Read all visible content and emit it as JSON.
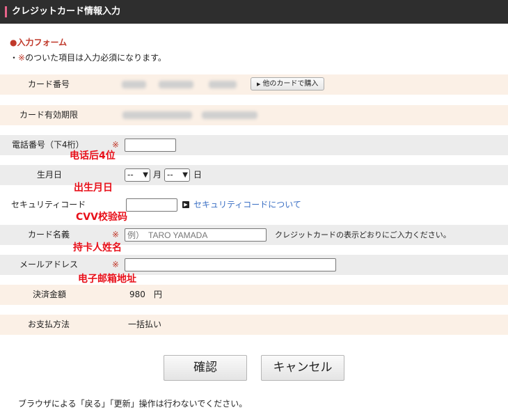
{
  "header": {
    "title": "クレジットカード情報入力"
  },
  "form_heading": "●入力フォーム",
  "note": {
    "prefix": "・",
    "req_mark": "※",
    "text": "のついた項目は入力必須になります。"
  },
  "rows": {
    "card_number": {
      "label": "カード番号",
      "other_card_button": "他のカードで購入"
    },
    "card_expiry": {
      "label": "カード有効期限"
    },
    "phone": {
      "label": "電話番号（下4桁）",
      "required": "※",
      "value": "",
      "annotation": "电话后4位"
    },
    "birthday": {
      "label": "生月日",
      "month_value": "--",
      "month_unit": "月",
      "day_value": "--",
      "day_unit": "日",
      "annotation": "出生月日"
    },
    "security": {
      "label": "セキュリティコード",
      "value": "",
      "link_icon": "▶",
      "link_text": "セキュリティコードについて",
      "annotation": "CVV校验码"
    },
    "card_name": {
      "label": "カード名義",
      "required": "※",
      "placeholder": "例）　TARO YAMADA",
      "hint": "クレジットカードの表示どおりにご入力ください。",
      "annotation": "持卡人姓名"
    },
    "email": {
      "label": "メールアドレス",
      "required": "※",
      "value": "",
      "annotation": "电子邮箱地址"
    },
    "amount": {
      "label": "決済金額",
      "value": "980　円"
    },
    "payment": {
      "label": "お支払方法",
      "value": "一括払い"
    }
  },
  "buttons": {
    "confirm": "確認",
    "cancel": "キャンセル"
  },
  "footer": "ブラウザによる「戻る」「更新」操作は行わないでください。",
  "colors": {
    "required": "#c0392b",
    "annotation": "#e8101a",
    "link": "#3a6fc4",
    "header_bg": "#2e2e2e",
    "header_accent": "#e8648a",
    "row_beige": "#fbf0e6",
    "row_gray": "#ececec"
  }
}
